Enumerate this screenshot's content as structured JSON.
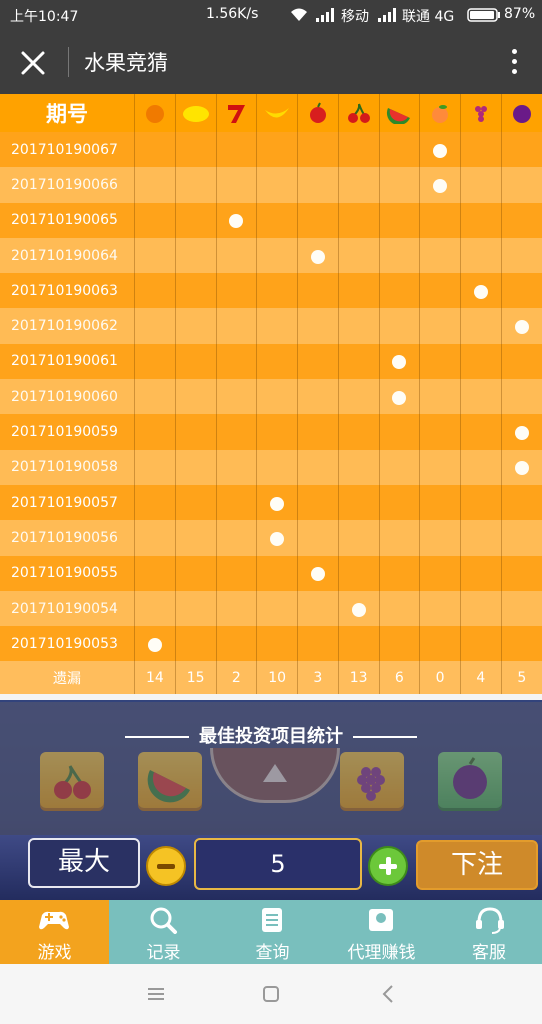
{
  "status_bar": {
    "time": "上午10:47",
    "speed": "1.56K/s",
    "carrier1": "移动",
    "carrier2": "联通 4G",
    "battery": "87%"
  },
  "header": {
    "title": "水果竞猜"
  },
  "table": {
    "period_header": "期号",
    "fruit_icons": [
      "orange-icon",
      "lemon-icon",
      "seven-icon",
      "banana-icon",
      "apple-icon",
      "cherry-icon",
      "watermelon-icon",
      "peach-icon",
      "grape-icon",
      "plum-icon"
    ],
    "rows": [
      {
        "period": "201710190067",
        "hit": 7
      },
      {
        "period": "201710190066",
        "hit": 7
      },
      {
        "period": "201710190065",
        "hit": 2
      },
      {
        "period": "201710190064",
        "hit": 4
      },
      {
        "period": "201710190063",
        "hit": 8
      },
      {
        "period": "201710190062",
        "hit": 9
      },
      {
        "period": "201710190061",
        "hit": 6
      },
      {
        "period": "201710190060",
        "hit": 6
      },
      {
        "period": "201710190059",
        "hit": 9
      },
      {
        "period": "201710190058",
        "hit": 9
      },
      {
        "period": "201710190057",
        "hit": 3
      },
      {
        "period": "201710190056",
        "hit": 3
      },
      {
        "period": "201710190055",
        "hit": 4
      },
      {
        "period": "201710190054",
        "hit": 5
      },
      {
        "period": "201710190053",
        "hit": 0
      }
    ],
    "missing_label": "遗漏",
    "missing_counts": [
      "14",
      "15",
      "2",
      "10",
      "3",
      "13",
      "6",
      "0",
      "4",
      "5"
    ]
  },
  "stats": {
    "title": "最佳投资项目统计"
  },
  "controls": {
    "max_label": "最大",
    "quantity": "5",
    "bet_label": "下注"
  },
  "tabs": [
    {
      "label": "游戏",
      "icon": "gamepad-icon"
    },
    {
      "label": "记录",
      "icon": "search-icon"
    },
    {
      "label": "查询",
      "icon": "document-icon"
    },
    {
      "label": "代理赚钱",
      "icon": "wallet-icon"
    },
    {
      "label": "客服",
      "icon": "headset-icon"
    }
  ],
  "colors": {
    "accent": "#ffa200",
    "row_alt": "#ffbb55",
    "tab_bar": "#79bfbd",
    "tab_active": "#f3a31e"
  }
}
